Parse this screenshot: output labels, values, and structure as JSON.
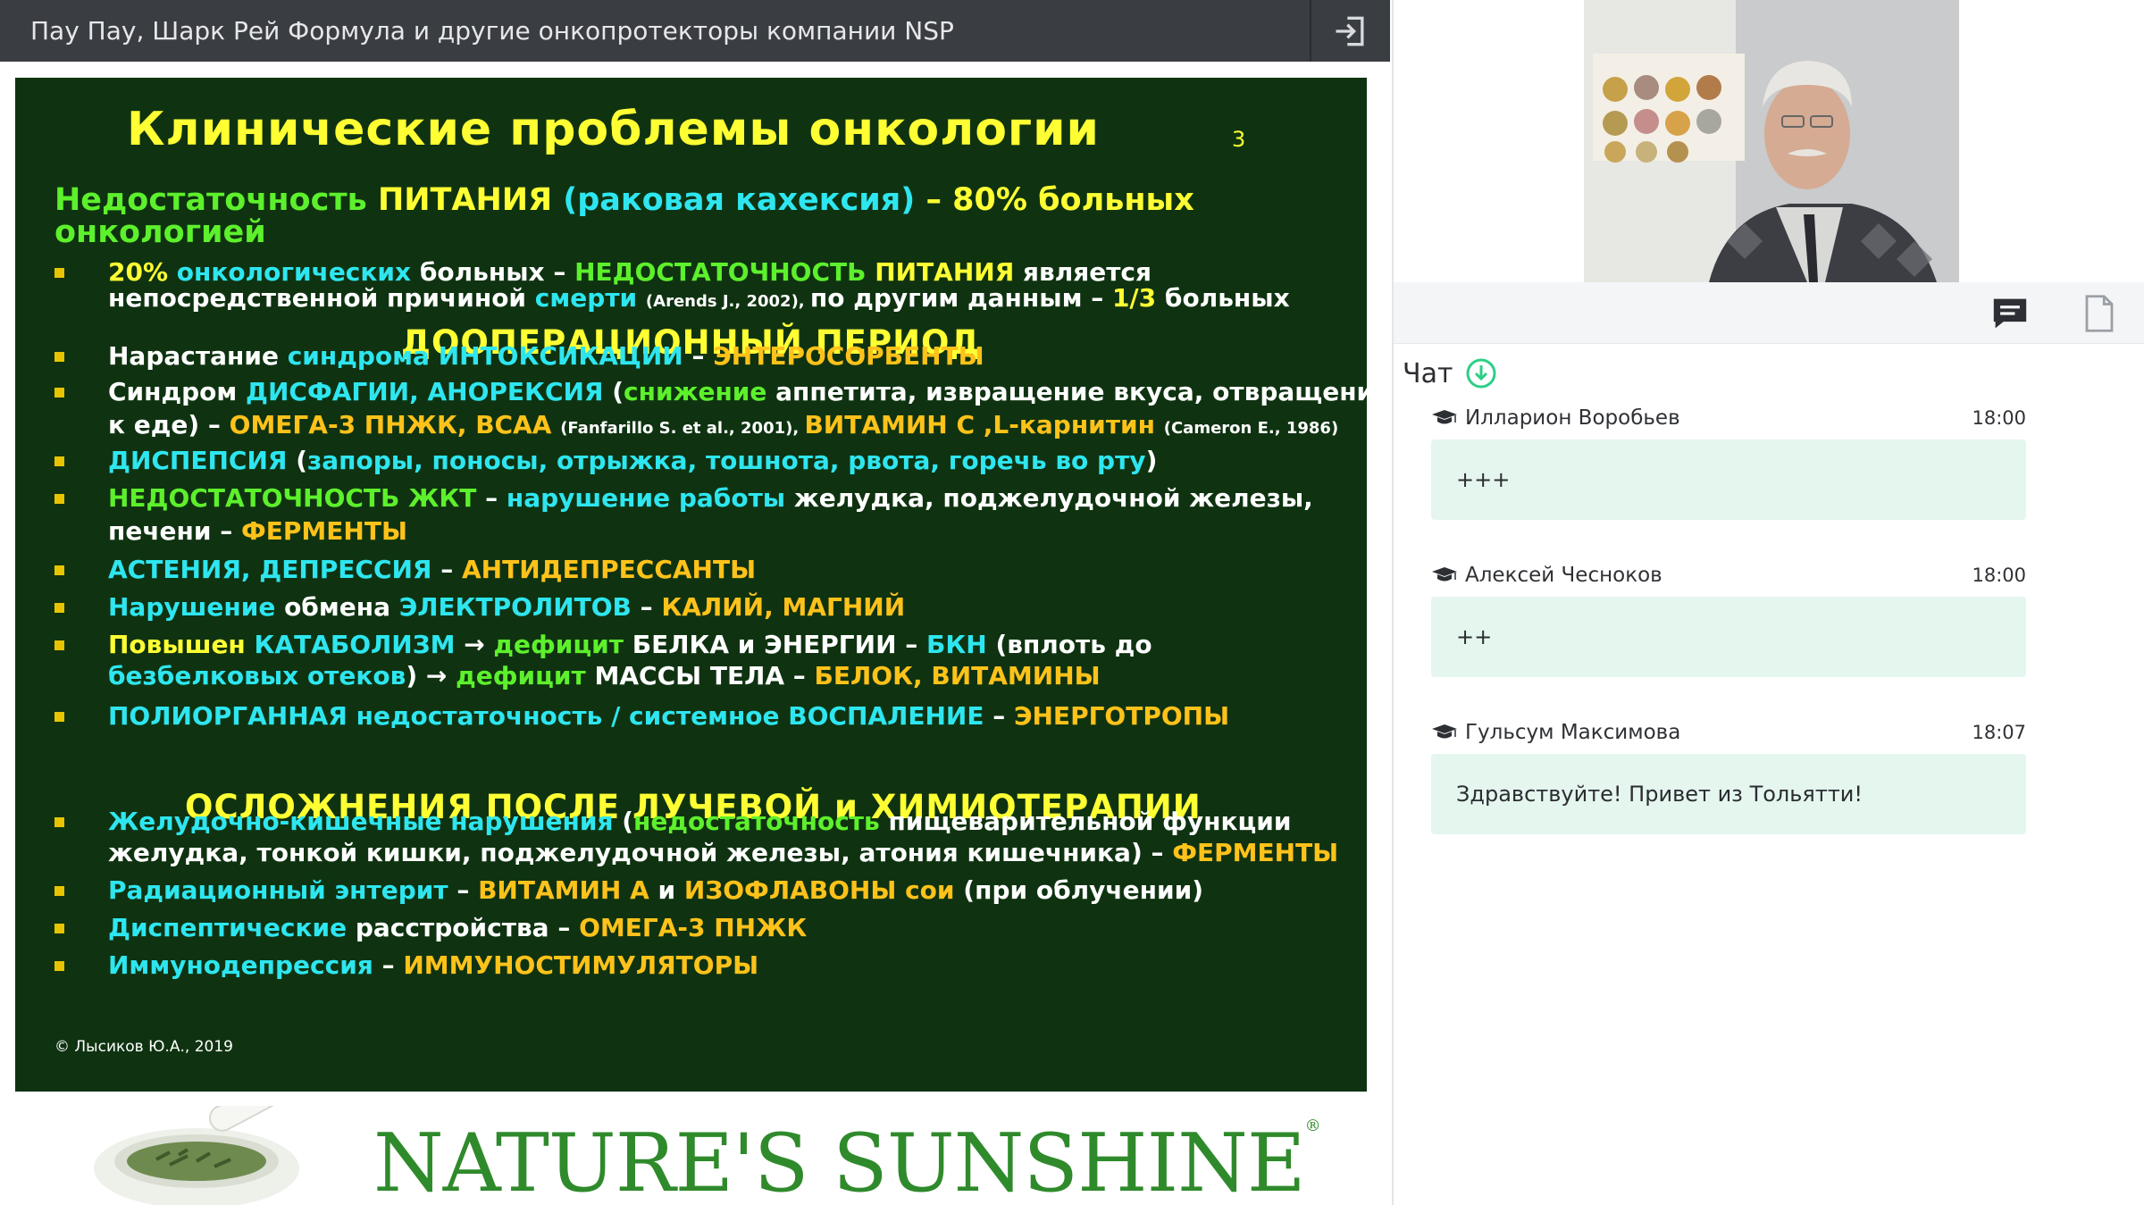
{
  "window": {
    "title": "Пау Пау, Шарк Рей Формула и другие онкопротекторы компании NSP",
    "exit_icon": "exit-to-app-icon"
  },
  "slide": {
    "title": "Клинические проблемы онкологии",
    "page_number": "3",
    "heading_l1": [
      {
        "text": "Недостаточность ",
        "color": "g"
      },
      {
        "text": "ПИТАНИЯ ",
        "color": "y"
      },
      {
        "text": "(раковая кахексия) ",
        "color": "c"
      },
      {
        "text": "– 80% больных",
        "color": "y"
      }
    ],
    "heading_l2": [
      {
        "text": "онкологией",
        "color": "g"
      }
    ],
    "section1": "ДООПЕРАЦИОННЫЙ  ПЕРИОД",
    "section2": "ОСЛОЖНЕНИЯ  ПОСЛЕ ЛУЧЕВОЙ и ХИМИОТЕРАПИИ",
    "lines": [
      {
        "bullet": true,
        "parts": [
          {
            "text": "20% ",
            "color": "y"
          },
          {
            "text": "онкологических ",
            "color": "c"
          },
          {
            "text": "больных – ",
            "color": "w"
          },
          {
            "text": "НЕДОСТАТОЧНОСТЬ ",
            "color": "g"
          },
          {
            "text": "ПИТАНИЯ ",
            "color": "y"
          },
          {
            "text": "является",
            "color": "w"
          }
        ]
      },
      {
        "bullet": false,
        "parts": [
          {
            "text": "непосредственной причиной ",
            "color": "w"
          },
          {
            "text": "смерти ",
            "color": "c"
          },
          {
            "text": "(Arends J., 2002), ",
            "color": "w",
            "small": true
          },
          {
            "text": "по другим данным – ",
            "color": "w"
          },
          {
            "text": "1/3 ",
            "color": "y"
          },
          {
            "text": "больных",
            "color": "w"
          }
        ]
      },
      {
        "bullet": true,
        "parts": [
          {
            "text": "Нарастание ",
            "color": "w"
          },
          {
            "text": "синдрома ",
            "color": "c"
          },
          {
            "text": "ИНТОКСИКАЦИИ ",
            "color": "c"
          },
          {
            "text": "– ",
            "color": "w"
          },
          {
            "text": "ЭНТЕРОСОРБЕНТЫ",
            "color": "o"
          }
        ]
      },
      {
        "bullet": true,
        "parts": [
          {
            "text": "Синдром ",
            "color": "w"
          },
          {
            "text": "ДИСФАГИИ, АНОРЕКСИЯ ",
            "color": "c"
          },
          {
            "text": "(",
            "color": "w"
          },
          {
            "text": "снижение ",
            "color": "g"
          },
          {
            "text": "аппетита, извращение вкуса, отвращение",
            "color": "w"
          }
        ]
      },
      {
        "bullet": false,
        "parts": [
          {
            "text": "к еде) – ",
            "color": "w"
          },
          {
            "text": "ОМЕГА-3 ПНЖК, ВСАА ",
            "color": "o"
          },
          {
            "text": "(Fanfarillo S. et al., 2001), ",
            "color": "w",
            "small": true
          },
          {
            "text": "ВИТАМИН С ,L-карнитин ",
            "color": "o"
          },
          {
            "text": "(Cameron E., 1986)",
            "color": "w",
            "small": true
          }
        ]
      },
      {
        "bullet": true,
        "parts": [
          {
            "text": "ДИСПЕПСИЯ ",
            "color": "c"
          },
          {
            "text": "(",
            "color": "w"
          },
          {
            "text": "запоры, поносы, отрыжка, тошнота, рвота, горечь во рту",
            "color": "c"
          },
          {
            "text": ")",
            "color": "w"
          }
        ]
      },
      {
        "bullet": true,
        "parts": [
          {
            "text": "НЕДОСТАТОЧНОСТЬ  ЖКТ ",
            "color": "g"
          },
          {
            "text": "– ",
            "color": "w"
          },
          {
            "text": "нарушение работы ",
            "color": "c"
          },
          {
            "text": "желудка, поджелудочной железы,",
            "color": "w"
          }
        ]
      },
      {
        "bullet": false,
        "parts": [
          {
            "text": "печени – ",
            "color": "w"
          },
          {
            "text": "ФЕРМЕНТЫ",
            "color": "o"
          }
        ]
      },
      {
        "bullet": true,
        "parts": [
          {
            "text": "АСТЕНИЯ, ДЕПРЕССИЯ ",
            "color": "c"
          },
          {
            "text": "– ",
            "color": "w"
          },
          {
            "text": "АНТИДЕПРЕССАНТЫ",
            "color": "o"
          }
        ]
      },
      {
        "bullet": true,
        "parts": [
          {
            "text": "Нарушение ",
            "color": "c"
          },
          {
            "text": "обмена ",
            "color": "w"
          },
          {
            "text": "ЭЛЕКТРОЛИТОВ ",
            "color": "c"
          },
          {
            "text": "– ",
            "color": "w"
          },
          {
            "text": "КАЛИЙ, МАГНИЙ",
            "color": "o"
          }
        ]
      },
      {
        "bullet": true,
        "parts": [
          {
            "text": "Повышен ",
            "color": "y"
          },
          {
            "text": "КАТАБОЛИЗМ ",
            "color": "c"
          },
          {
            "text": "→ ",
            "color": "w"
          },
          {
            "text": "дефицит ",
            "color": "g"
          },
          {
            "text": "БЕЛКА и ЭНЕРГИИ ",
            "color": "w"
          },
          {
            "text": "– ",
            "color": "w"
          },
          {
            "text": "БКН ",
            "color": "c"
          },
          {
            "text": "(вплоть до",
            "color": "w"
          }
        ]
      },
      {
        "bullet": false,
        "parts": [
          {
            "text": "безбелковых отеков",
            "color": "c"
          },
          {
            "text": ") → ",
            "color": "w"
          },
          {
            "text": "дефицит ",
            "color": "g"
          },
          {
            "text": "МАССЫ ТЕЛА ",
            "color": "w"
          },
          {
            "text": "– ",
            "color": "w"
          },
          {
            "text": "БЕЛОК, ВИТАМИНЫ",
            "color": "o"
          }
        ]
      },
      {
        "bullet": true,
        "parts": [
          {
            "text": "ПОЛИОРГАННАЯ недостаточность / системное ВОСПАЛЕНИЕ ",
            "color": "c"
          },
          {
            "text": "– ",
            "color": "w"
          },
          {
            "text": "ЭНЕРГОТРОПЫ",
            "color": "o"
          }
        ]
      },
      {
        "bullet": true,
        "parts": [
          {
            "text": "Желудочно-кишечные нарушения ",
            "color": "c"
          },
          {
            "text": "(",
            "color": "w"
          },
          {
            "text": "недостаточность ",
            "color": "g"
          },
          {
            "text": "пищеварительной функции",
            "color": "w"
          }
        ]
      },
      {
        "bullet": false,
        "parts": [
          {
            "text": "желудка, тонкой кишки, поджелудочной железы, атония кишечника) – ",
            "color": "w"
          },
          {
            "text": "ФЕРМЕНТЫ",
            "color": "o"
          }
        ]
      },
      {
        "bullet": true,
        "parts": [
          {
            "text": "Радиационный энтерит ",
            "color": "c"
          },
          {
            "text": "– ",
            "color": "w"
          },
          {
            "text": "ВИТАМИН А ",
            "color": "o"
          },
          {
            "text": "и ",
            "color": "w"
          },
          {
            "text": "ИЗОФЛАВОНЫ сои ",
            "color": "o"
          },
          {
            "text": "(при облучении)",
            "color": "w"
          }
        ]
      },
      {
        "bullet": true,
        "parts": [
          {
            "text": "Диспептические ",
            "color": "c"
          },
          {
            "text": "расстройства ",
            "color": "w"
          },
          {
            "text": "– ",
            "color": "w"
          },
          {
            "text": "ОМЕГА-3 ПНЖК",
            "color": "o"
          }
        ]
      },
      {
        "bullet": true,
        "parts": [
          {
            "text": "Иммунодепрессия ",
            "color": "c"
          },
          {
            "text": "– ",
            "color": "w"
          },
          {
            "text": "ИММУНОСТИМУЛЯТОРЫ",
            "color": "o"
          }
        ]
      }
    ],
    "copyright": "© Лысиков Ю.А., 2019"
  },
  "logo": {
    "text": "NATURE'S SUNSHINE",
    "reg": "®"
  },
  "right_panel": {
    "chat_tab_icon": "chat-bubble-icon",
    "files_tab_icon": "file-icon",
    "chat_title": "Чат",
    "chat_title_icon": "scroll-down-circle-icon",
    "messages": [
      {
        "author": "Илларион Воробьев",
        "time": "18:00",
        "text": "+++",
        "icon": "graduation-cap-icon"
      },
      {
        "author": "Алексей Чесноков",
        "time": "18:00",
        "text": "++",
        "icon": "graduation-cap-icon"
      },
      {
        "author": "Гульсум Максимова",
        "time": "18:07",
        "text": "Здравствуйте! Привет из Тольятти!",
        "icon": "graduation-cap-icon"
      }
    ]
  }
}
